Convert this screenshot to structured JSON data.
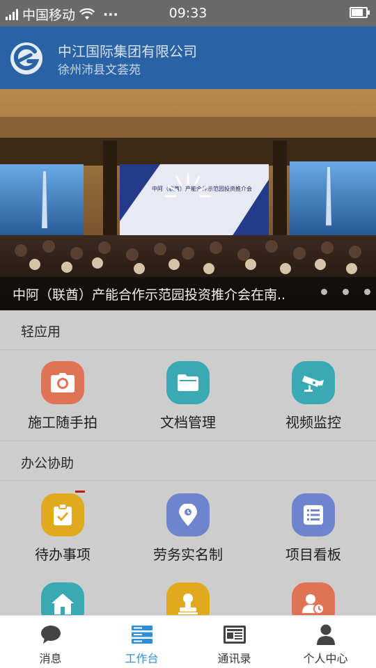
{
  "status_bar": {
    "carrier": "中国移动",
    "more": "···",
    "time": "09:33"
  },
  "header": {
    "company": "中江国际集团有限公司",
    "project": "徐州沛县文荟苑"
  },
  "banner": {
    "caption": "中阿（联酋）产能合作示范园投资推介会在南..",
    "screen_text": "中阿（联酋）产能合作示范园投资推介会",
    "slide_count": 3
  },
  "sections": [
    {
      "title": "轻应用",
      "apps": [
        {
          "label": "施工随手拍",
          "icon": "camera-icon",
          "color": "#e07355"
        },
        {
          "label": "文档管理",
          "icon": "folder-icon",
          "color": "#39a9b4"
        },
        {
          "label": "视频监控",
          "icon": "cctv-camera-icon",
          "color": "#39a9b4"
        }
      ]
    },
    {
      "title": "办公协助",
      "apps": [
        {
          "label": "待办事项",
          "icon": "clipboard-check-icon",
          "color": "#e0a91e"
        },
        {
          "label": "劳务实名制",
          "icon": "location-pin-icon",
          "color": "#6f84cf"
        },
        {
          "label": "项目看板",
          "icon": "list-board-icon",
          "color": "#6f84cf"
        },
        {
          "label": "",
          "icon": "home-icon",
          "color": "#39a9b4"
        },
        {
          "label": "",
          "icon": "stamp-icon",
          "color": "#e0a91e"
        },
        {
          "label": "",
          "icon": "user-clock-icon",
          "color": "#e07355"
        }
      ]
    }
  ],
  "tabbar": [
    {
      "label": "消息",
      "icon": "chat-bubble-icon",
      "active": false
    },
    {
      "label": "工作台",
      "icon": "server-stack-icon",
      "active": true
    },
    {
      "label": "通讯录",
      "icon": "newspaper-icon",
      "active": false
    },
    {
      "label": "个人中心",
      "icon": "person-icon",
      "active": false
    }
  ],
  "colors": {
    "header": "#2a62a6",
    "status_bar": "#6a6a6a",
    "active_tab": "#2e8fd6",
    "content_bg": "#cdcdcd"
  }
}
